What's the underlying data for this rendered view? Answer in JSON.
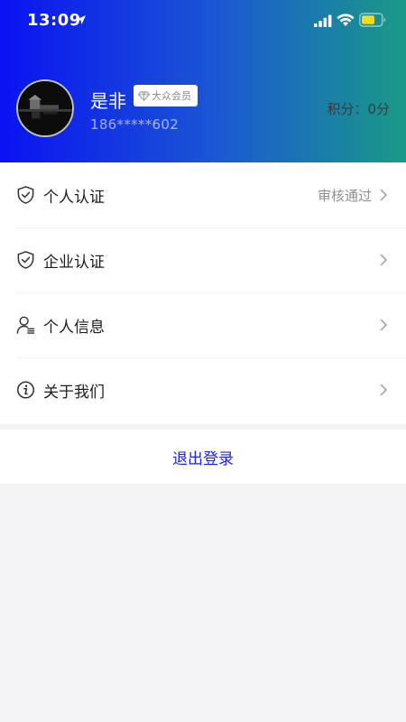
{
  "status_bar": {
    "time": "13:09",
    "icons": [
      "location-arrow-icon",
      "cellular-signal-icon",
      "wifi-icon",
      "battery-icon"
    ],
    "battery_color": "#f0de1e"
  },
  "profile": {
    "name": "是非",
    "member_badge": "大众会员",
    "phone": "186*****602",
    "points_text": "积分：0分"
  },
  "menu": [
    {
      "label": "个人认证",
      "status": "审核通过",
      "icon": "shield-check-icon"
    },
    {
      "label": "企业认证",
      "status": "",
      "icon": "shield-check-icon"
    },
    {
      "label": "个人信息",
      "status": "",
      "icon": "user-info-icon"
    },
    {
      "label": "关于我们",
      "status": "",
      "icon": "info-icon"
    }
  ],
  "logout_label": "退出登录",
  "colors": {
    "header_gradient": [
      "#0a12f2",
      "#1b5ad2",
      "#1a9a86"
    ],
    "logout_text": "#1e24d4",
    "background": "#f4f3f6"
  }
}
